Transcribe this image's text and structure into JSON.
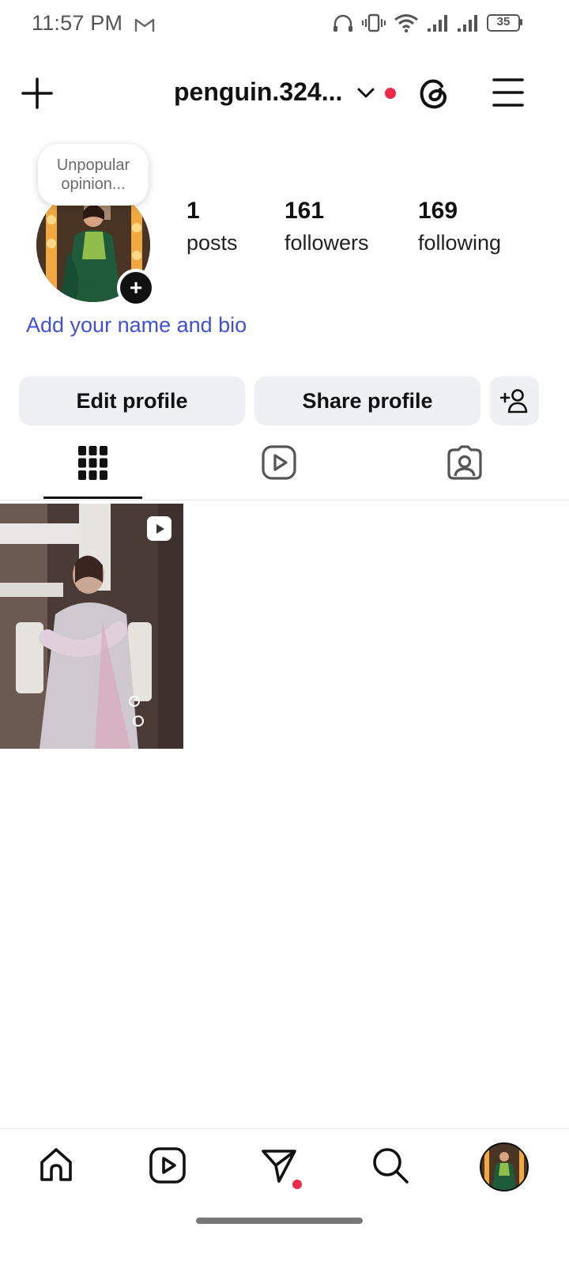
{
  "status_bar": {
    "time": "11:57 PM",
    "battery": "35"
  },
  "header": {
    "username": "penguin.324..."
  },
  "note": {
    "text_line1": "Unpopular",
    "text_line2": "opinion..."
  },
  "stats": {
    "posts": {
      "count": "1",
      "label": "posts"
    },
    "followers": {
      "count": "161",
      "label": "followers"
    },
    "following": {
      "count": "169",
      "label": "following"
    }
  },
  "bio": {
    "add_link": "Add your name and bio"
  },
  "buttons": {
    "edit_profile": "Edit profile",
    "share_profile": "Share profile"
  },
  "tabs": [
    {
      "icon": "grid-icon",
      "selected": true
    },
    {
      "icon": "reels-icon",
      "selected": false
    },
    {
      "icon": "tagged-icon",
      "selected": false
    }
  ],
  "bottom_nav": [
    {
      "icon": "home-icon"
    },
    {
      "icon": "reels-icon"
    },
    {
      "icon": "messages-icon",
      "has_notification": true
    },
    {
      "icon": "search-icon"
    },
    {
      "icon": "profile-avatar"
    }
  ],
  "colors": {
    "accent_link": "#4150d6",
    "notification_dot": "#ee2a4b",
    "button_bg": "#eff0f3"
  }
}
